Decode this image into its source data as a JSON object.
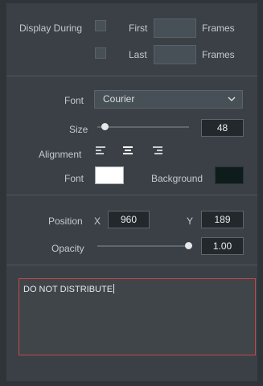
{
  "display": {
    "label": "Display During",
    "first_label": "First",
    "last_label": "Last",
    "frames_label_1": "Frames",
    "frames_label_2": "Frames"
  },
  "font": {
    "label": "Font",
    "value": "Courier"
  },
  "size": {
    "label": "Size",
    "value": "48",
    "slider_fraction": 0.05
  },
  "alignment": {
    "label": "Alignment",
    "selected": "center"
  },
  "colors": {
    "font_label": "Font",
    "background_label": "Background",
    "font_color": "#ffffff",
    "background_color": "#0f1c1c"
  },
  "position": {
    "label": "Position",
    "x_label": "X",
    "x_value": "960",
    "y_label": "Y",
    "y_value": "189"
  },
  "opacity": {
    "label": "Opacity",
    "value": "1.00",
    "slider_fraction": 1.0
  },
  "text": {
    "value": "DO NOT DISTRIBUTE"
  }
}
